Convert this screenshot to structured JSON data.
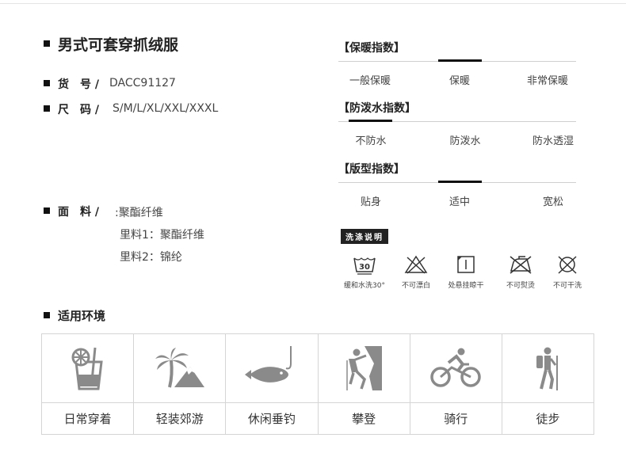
{
  "product": {
    "title": "男式可套穿抓绒服",
    "sku_label": "货　号 /",
    "sku_value": "DACC91127",
    "size_label": "尺　码 /",
    "size_value": "S/M/L/XL/XXL/XXXL",
    "fabric_label": "面　料 /",
    "fabric_value": ":聚酯纤维",
    "lining1": "里料1：聚酯纤维",
    "lining2": "里料2：锦纶"
  },
  "indices": [
    {
      "title": "【保暖指数】",
      "options": [
        "一般保暖",
        "保暖",
        "非常保暖"
      ],
      "active_index": 1
    },
    {
      "title": "【防泼水指数】",
      "options": [
        "不防水",
        "防泼水",
        "防水透湿"
      ],
      "active_index": 0
    },
    {
      "title": "【版型指数】",
      "options": [
        "贴身",
        "适中",
        "宽松"
      ],
      "active_index": 1
    }
  ],
  "wash": {
    "title": "洗涤说明",
    "items": [
      {
        "icon": "wash-30-icon",
        "number": "30",
        "label": "缓和水洗30°"
      },
      {
        "icon": "no-bleach-icon",
        "label": "不可漂白"
      },
      {
        "icon": "line-dry-shade-icon",
        "label": "处悬挂晾干"
      },
      {
        "icon": "no-iron-icon",
        "label": "不可熨烫"
      },
      {
        "icon": "no-dry-clean-icon",
        "label": "不可干洗"
      }
    ]
  },
  "environment": {
    "title": "适用环境",
    "items": [
      {
        "icon": "drink-cup-icon",
        "label": "日常穿着"
      },
      {
        "icon": "palm-tree-icon",
        "label": "轻装郊游"
      },
      {
        "icon": "fish-hook-icon",
        "label": "休闲垂钓"
      },
      {
        "icon": "climber-icon",
        "label": "攀登"
      },
      {
        "icon": "cyclist-icon",
        "label": "骑行"
      },
      {
        "icon": "hiker-icon",
        "label": "徒步"
      }
    ]
  },
  "colors": {
    "text": "#333333",
    "accent": "#111111",
    "icon_gray": "#8a8a8a",
    "border": "#d5d5d5"
  }
}
